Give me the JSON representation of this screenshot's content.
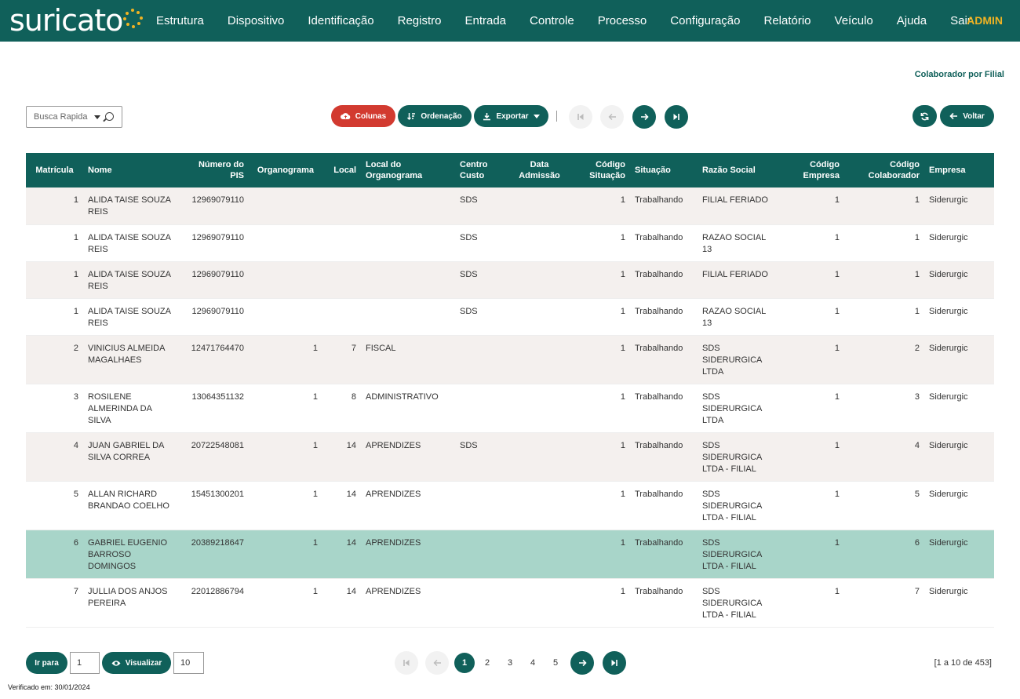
{
  "app": {
    "logo": "suricato",
    "user": "ADMIN"
  },
  "nav": [
    "Estrutura",
    "Dispositivo",
    "Identificação",
    "Registro",
    "Entrada",
    "Controle",
    "Processo",
    "Configuração",
    "Relatório",
    "Veículo",
    "Ajuda",
    "Sair"
  ],
  "page": {
    "title": "Colaborador por Filial"
  },
  "toolbar": {
    "search_placeholder": "Busca Rapida",
    "columns_label": "Colunas",
    "order_label": "Ordenação",
    "export_label": "Exportar",
    "back_label": "Voltar"
  },
  "colors": {
    "primary": "#10605a",
    "danger": "#d23a30",
    "accent": "#f0b323",
    "row_alt": "#f4f0ee",
    "row_selected": "#a8d5c9"
  },
  "table": {
    "headers": [
      "Matrícula",
      "Nome",
      "Número do PIS",
      "Organograma",
      "Local",
      "Local do Organograma",
      "Centro Custo",
      "Data Admissão",
      "Código Situação",
      "Situação",
      "Razão Social",
      "Código Empresa",
      "Código Colaborador",
      "Empresa"
    ],
    "rows": [
      [
        "1",
        "ALIDA TAISE SOUZA REIS",
        "12969079110",
        "",
        "",
        "",
        "SDS",
        "",
        "1",
        "Trabalhando",
        "FILIAL FERIADO",
        "1",
        "1",
        "Siderurgic"
      ],
      [
        "1",
        "ALIDA TAISE SOUZA REIS",
        "12969079110",
        "",
        "",
        "",
        "SDS",
        "",
        "1",
        "Trabalhando",
        "RAZAO SOCIAL 13",
        "1",
        "1",
        "Siderurgic"
      ],
      [
        "1",
        "ALIDA TAISE SOUZA REIS",
        "12969079110",
        "",
        "",
        "",
        "SDS",
        "",
        "1",
        "Trabalhando",
        "FILIAL FERIADO",
        "1",
        "1",
        "Siderurgic"
      ],
      [
        "1",
        "ALIDA TAISE SOUZA REIS",
        "12969079110",
        "",
        "",
        "",
        "SDS",
        "",
        "1",
        "Trabalhando",
        "RAZAO SOCIAL 13",
        "1",
        "1",
        "Siderurgic"
      ],
      [
        "2",
        "VINICIUS ALMEIDA MAGALHAES",
        "12471764470",
        "1",
        "7",
        "FISCAL",
        "",
        "",
        "1",
        "Trabalhando",
        "SDS SIDERURGICA LTDA",
        "1",
        "2",
        "Siderurgic"
      ],
      [
        "3",
        "ROSILENE ALMERINDA DA SILVA",
        "13064351132",
        "1",
        "8",
        "ADMINISTRATIVO",
        "",
        "",
        "1",
        "Trabalhando",
        "SDS SIDERURGICA LTDA",
        "1",
        "3",
        "Siderurgic"
      ],
      [
        "4",
        "JUAN GABRIEL DA SILVA CORREA",
        "20722548081",
        "1",
        "14",
        "APRENDIZES",
        "SDS",
        "",
        "1",
        "Trabalhando",
        "SDS SIDERURGICA LTDA - FILIAL",
        "1",
        "4",
        "Siderurgic"
      ],
      [
        "5",
        "ALLAN RICHARD BRANDAO COELHO",
        "15451300201",
        "1",
        "14",
        "APRENDIZES",
        "",
        "",
        "1",
        "Trabalhando",
        "SDS SIDERURGICA LTDA - FILIAL",
        "1",
        "5",
        "Siderurgic"
      ],
      [
        "6",
        "GABRIEL EUGENIO BARROSO DOMINGOS",
        "20389218647",
        "1",
        "14",
        "APRENDIZES",
        "",
        "",
        "1",
        "Trabalhando",
        "SDS SIDERURGICA LTDA - FILIAL",
        "1",
        "6",
        "Siderurgic"
      ],
      [
        "7",
        "JULLIA DOS ANJOS PEREIRA",
        "22012886794",
        "1",
        "14",
        "APRENDIZES",
        "",
        "",
        "1",
        "Trabalhando",
        "SDS SIDERURGICA LTDA - FILIAL",
        "1",
        "7",
        "Siderurgic"
      ]
    ],
    "selected_row": 8
  },
  "footer": {
    "goto_label": "Ir para",
    "goto_value": "1",
    "view_label": "Visualizar",
    "view_value": "10",
    "pages": [
      "1",
      "2",
      "3",
      "4",
      "5"
    ],
    "current_page": "1",
    "range_text": "[1 a 10 de 453]",
    "verified_text": "Verificado em: 30/01/2024"
  }
}
